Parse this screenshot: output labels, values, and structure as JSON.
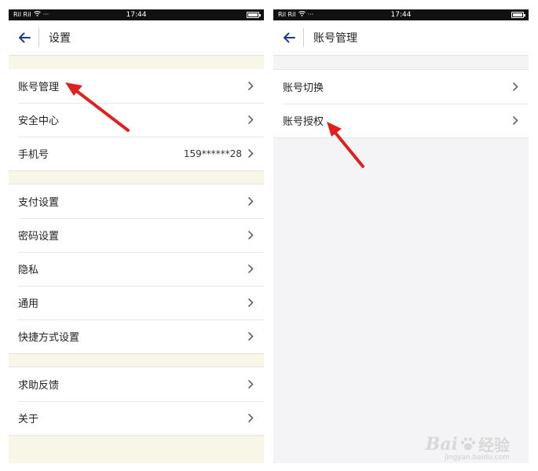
{
  "status_bar": {
    "time": "17:44",
    "signal_left": "Ril Ril",
    "more": "···"
  },
  "left_screen": {
    "title": "设置",
    "groups": [
      {
        "items": [
          {
            "label": "账号管理",
            "value": ""
          },
          {
            "label": "安全中心",
            "value": ""
          },
          {
            "label": "手机号",
            "value": "159******28"
          }
        ]
      },
      {
        "items": [
          {
            "label": "支付设置",
            "value": ""
          },
          {
            "label": "密码设置",
            "value": ""
          },
          {
            "label": "隐私",
            "value": ""
          },
          {
            "label": "通用",
            "value": ""
          },
          {
            "label": "快捷方式设置",
            "value": ""
          }
        ]
      },
      {
        "items": [
          {
            "label": "求助反馈",
            "value": ""
          },
          {
            "label": "关于",
            "value": ""
          }
        ]
      }
    ]
  },
  "right_screen": {
    "title": "账号管理",
    "items": [
      {
        "label": "账号切换"
      },
      {
        "label": "账号授权"
      }
    ]
  },
  "colors": {
    "accent": "#1f3a93",
    "annotation_arrow": "#e02020",
    "section_gap": "#f8f6e6"
  },
  "watermark": {
    "main": "Bai",
    "main_suffix": "经验",
    "sub": "jingyan.baidu.com"
  },
  "icons": {
    "back": "arrow-left-icon",
    "chevron": "chevron-right-icon"
  }
}
